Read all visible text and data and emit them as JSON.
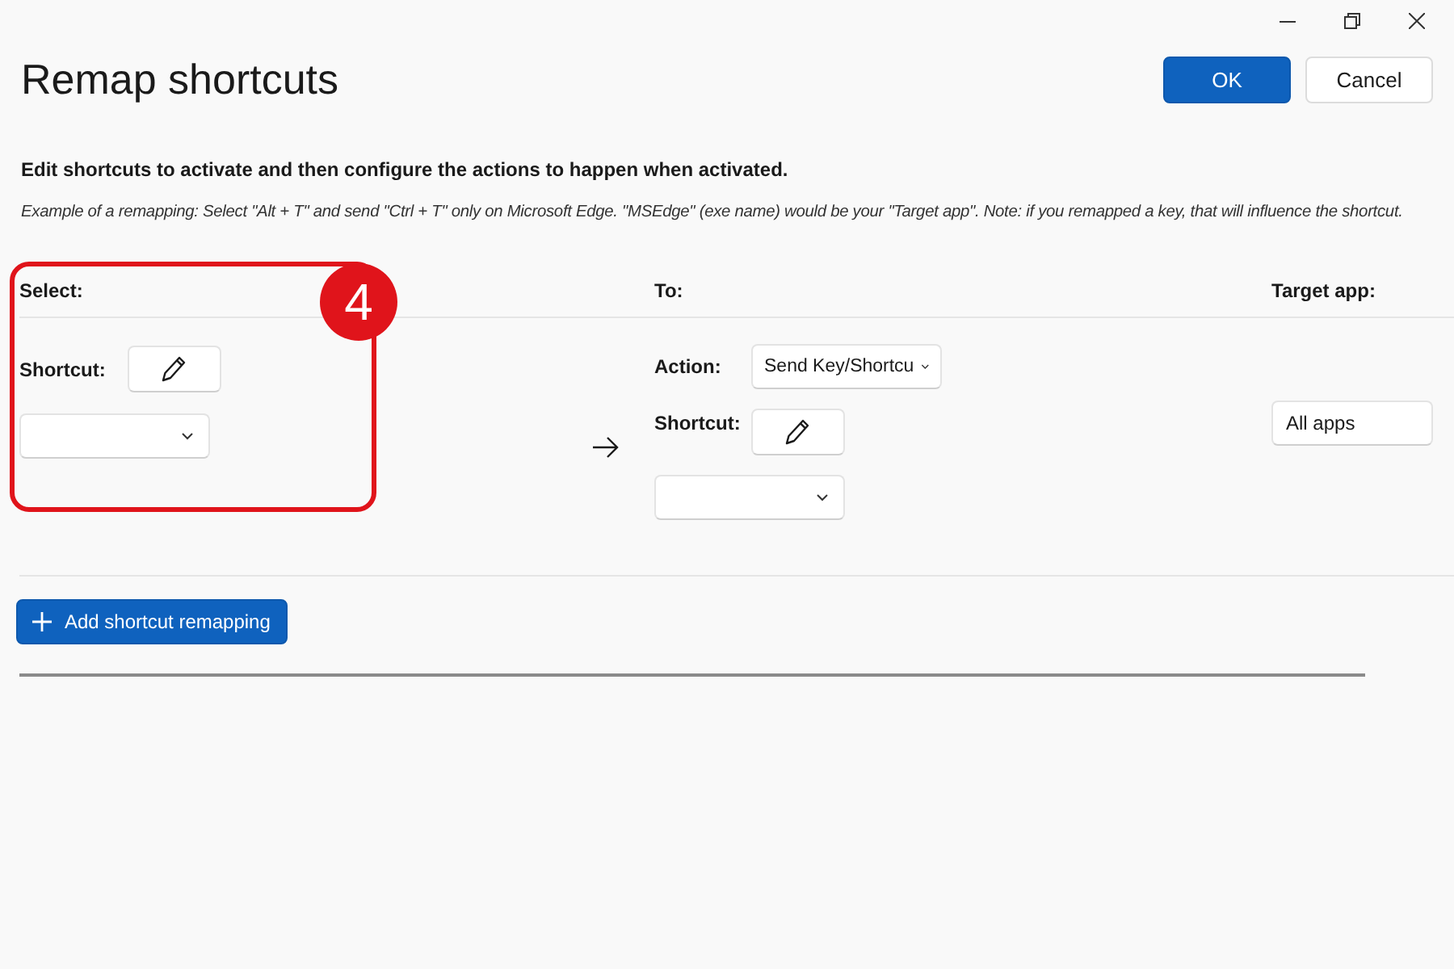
{
  "window": {
    "title": "Remap shortcuts"
  },
  "buttons": [
    {
      "label": "OK",
      "kind": "primary"
    },
    {
      "label": "Cancel",
      "kind": "secondary"
    }
  ],
  "description": "Edit shortcuts to activate and then configure the actions to happen when activated.",
  "example": "Example of a remapping: Select \"Alt + T\" and send \"Ctrl + T\" only on Microsoft Edge. \"MSEdge\" (exe name) would be your \"Target app\". Note: if you remapped a key, that will influence the shortcut.",
  "columns": [
    "Select:",
    "To:",
    "Target app:"
  ],
  "remapping": {
    "select": {
      "shortcut_label": "Shortcut:"
    },
    "to": {
      "action_label": "Action:",
      "action_value": "Send Key/Shortcu",
      "shortcut_label": "Shortcut:"
    },
    "target_app": "All apps"
  },
  "add_button": "Add shortcut remapping",
  "annotation": {
    "number": "4"
  }
}
